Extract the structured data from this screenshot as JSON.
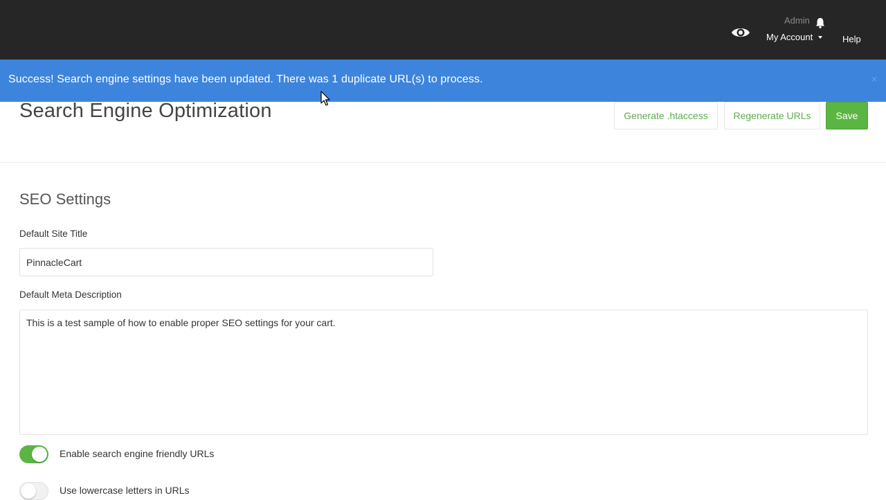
{
  "header": {
    "admin_label": "Admin",
    "account_label": "My Account",
    "help_label": "Help",
    "icons": [
      "eye-icon",
      "bell-icon",
      "caret-down-icon"
    ]
  },
  "alert": {
    "message": "Success! Search engine settings have been updated. There was 1 duplicate URL(s) to process.",
    "close_label": "×",
    "color": "#3d85dc"
  },
  "page": {
    "title": "Search Engine Optimization"
  },
  "toolbar": {
    "generate_label": "Generate .htaccess",
    "regenerate_label": "Regenerate URLs",
    "save_label": "Save",
    "accent_color": "#5bb543"
  },
  "seo_settings": {
    "section_title": "SEO Settings",
    "site_title_label": "Default Site Title",
    "site_title_value": "PinnacleCart",
    "meta_desc_label": "Default Meta Description",
    "meta_desc_value": "This is a test sample of how to enable proper SEO settings for your cart.",
    "toggles": [
      {
        "label": "Enable search engine friendly URLs",
        "checked": true
      },
      {
        "label": "Use lowercase letters in URLs",
        "checked": false
      }
    ]
  }
}
